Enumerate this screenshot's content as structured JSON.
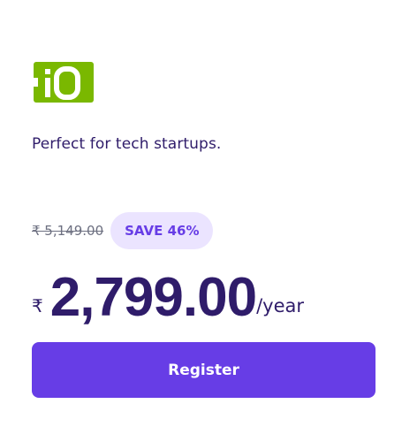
{
  "logo": {
    "icon": "io-domain-logo",
    "color": "#7ab800",
    "text": "iO"
  },
  "plan": {
    "tagline": "Perfect for tech startups.",
    "old_price": "₹ 5,149.00",
    "save_badge": "SAVE 46%",
    "currency": "₹",
    "price": "2,799.00",
    "period": "/year"
  },
  "actions": {
    "register_label": "Register"
  },
  "colors": {
    "accent": "#673de6",
    "text": "#2f1c6a",
    "badge_bg": "#ebe4ff",
    "muted": "#6d7081"
  }
}
